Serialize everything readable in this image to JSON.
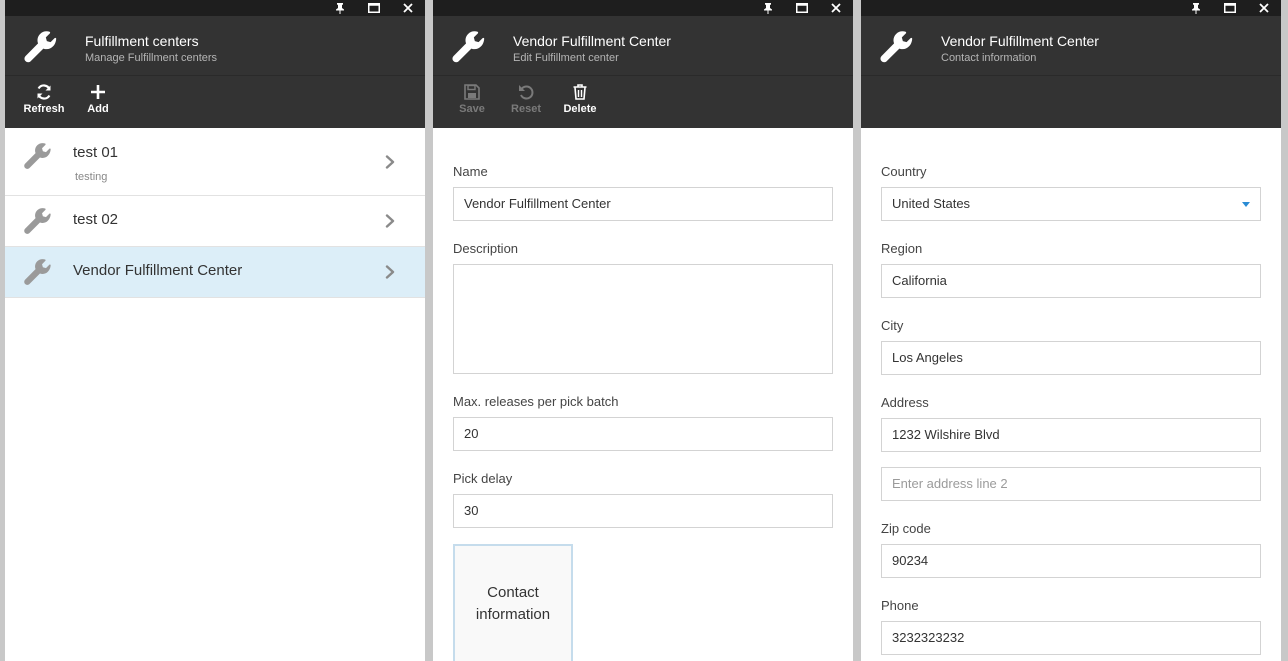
{
  "window_controls": {
    "pin": "pin-icon",
    "maximize": "maximize-icon",
    "close": "close-icon"
  },
  "blade1": {
    "title": "Fulfillment centers",
    "subtitle": "Manage Fulfillment centers",
    "toolbar": {
      "refresh": "Refresh",
      "add": "Add"
    },
    "items": [
      {
        "name": "test 01",
        "description": "testing"
      },
      {
        "name": "test 02",
        "description": ""
      },
      {
        "name": "Vendor Fulfillment Center",
        "description": ""
      }
    ],
    "selected_index": 2
  },
  "blade2": {
    "title": "Vendor Fulfillment Center",
    "subtitle": "Edit Fulfillment center",
    "toolbar": {
      "save": "Save",
      "reset": "Reset",
      "delete": "Delete"
    },
    "form": {
      "name_label": "Name",
      "name_value": "Vendor Fulfillment Center",
      "description_label": "Description",
      "description_value": "",
      "max_releases_label": "Max. releases per pick batch",
      "max_releases_value": "20",
      "pick_delay_label": "Pick delay",
      "pick_delay_value": "30",
      "contact_tile": "Contact information"
    }
  },
  "blade3": {
    "title": "Vendor Fulfillment Center",
    "subtitle": "Contact information",
    "form": {
      "country_label": "Country",
      "country_value": "United States",
      "region_label": "Region",
      "region_value": "California",
      "city_label": "City",
      "city_value": "Los Angeles",
      "address_label": "Address",
      "address_value": "1232 Wilshire Blvd",
      "address2_placeholder": "Enter address line 2",
      "zip_label": "Zip code",
      "zip_value": "90234",
      "phone_label": "Phone",
      "phone_value": "3232323232"
    }
  },
  "colors": {
    "header_bg": "#333333",
    "topbar_bg": "#1e1e1e",
    "selected_bg": "#dceef8",
    "accent": "#2a8bd4"
  }
}
